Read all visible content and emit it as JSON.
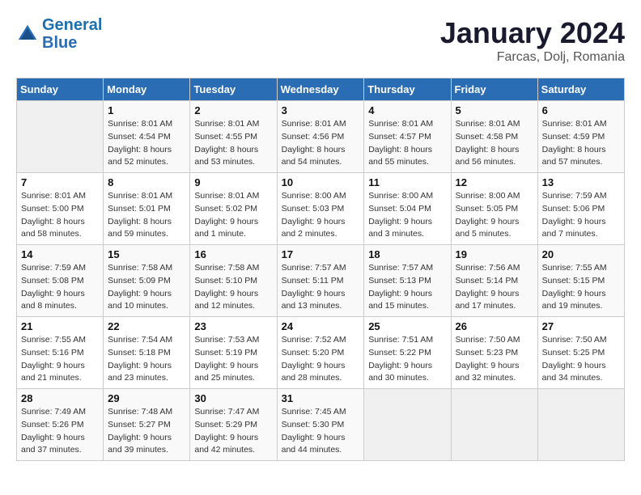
{
  "header": {
    "logo_line1": "General",
    "logo_line2": "Blue",
    "title": "January 2024",
    "subtitle": "Farcas, Dolj, Romania"
  },
  "weekdays": [
    "Sunday",
    "Monday",
    "Tuesday",
    "Wednesday",
    "Thursday",
    "Friday",
    "Saturday"
  ],
  "weeks": [
    [
      {
        "day": "",
        "sunrise": "",
        "sunset": "",
        "daylight": ""
      },
      {
        "day": "1",
        "sunrise": "Sunrise: 8:01 AM",
        "sunset": "Sunset: 4:54 PM",
        "daylight": "Daylight: 8 hours and 52 minutes."
      },
      {
        "day": "2",
        "sunrise": "Sunrise: 8:01 AM",
        "sunset": "Sunset: 4:55 PM",
        "daylight": "Daylight: 8 hours and 53 minutes."
      },
      {
        "day": "3",
        "sunrise": "Sunrise: 8:01 AM",
        "sunset": "Sunset: 4:56 PM",
        "daylight": "Daylight: 8 hours and 54 minutes."
      },
      {
        "day": "4",
        "sunrise": "Sunrise: 8:01 AM",
        "sunset": "Sunset: 4:57 PM",
        "daylight": "Daylight: 8 hours and 55 minutes."
      },
      {
        "day": "5",
        "sunrise": "Sunrise: 8:01 AM",
        "sunset": "Sunset: 4:58 PM",
        "daylight": "Daylight: 8 hours and 56 minutes."
      },
      {
        "day": "6",
        "sunrise": "Sunrise: 8:01 AM",
        "sunset": "Sunset: 4:59 PM",
        "daylight": "Daylight: 8 hours and 57 minutes."
      }
    ],
    [
      {
        "day": "7",
        "sunrise": "Sunrise: 8:01 AM",
        "sunset": "Sunset: 5:00 PM",
        "daylight": "Daylight: 8 hours and 58 minutes."
      },
      {
        "day": "8",
        "sunrise": "Sunrise: 8:01 AM",
        "sunset": "Sunset: 5:01 PM",
        "daylight": "Daylight: 8 hours and 59 minutes."
      },
      {
        "day": "9",
        "sunrise": "Sunrise: 8:01 AM",
        "sunset": "Sunset: 5:02 PM",
        "daylight": "Daylight: 9 hours and 1 minute."
      },
      {
        "day": "10",
        "sunrise": "Sunrise: 8:00 AM",
        "sunset": "Sunset: 5:03 PM",
        "daylight": "Daylight: 9 hours and 2 minutes."
      },
      {
        "day": "11",
        "sunrise": "Sunrise: 8:00 AM",
        "sunset": "Sunset: 5:04 PM",
        "daylight": "Daylight: 9 hours and 3 minutes."
      },
      {
        "day": "12",
        "sunrise": "Sunrise: 8:00 AM",
        "sunset": "Sunset: 5:05 PM",
        "daylight": "Daylight: 9 hours and 5 minutes."
      },
      {
        "day": "13",
        "sunrise": "Sunrise: 7:59 AM",
        "sunset": "Sunset: 5:06 PM",
        "daylight": "Daylight: 9 hours and 7 minutes."
      }
    ],
    [
      {
        "day": "14",
        "sunrise": "Sunrise: 7:59 AM",
        "sunset": "Sunset: 5:08 PM",
        "daylight": "Daylight: 9 hours and 8 minutes."
      },
      {
        "day": "15",
        "sunrise": "Sunrise: 7:58 AM",
        "sunset": "Sunset: 5:09 PM",
        "daylight": "Daylight: 9 hours and 10 minutes."
      },
      {
        "day": "16",
        "sunrise": "Sunrise: 7:58 AM",
        "sunset": "Sunset: 5:10 PM",
        "daylight": "Daylight: 9 hours and 12 minutes."
      },
      {
        "day": "17",
        "sunrise": "Sunrise: 7:57 AM",
        "sunset": "Sunset: 5:11 PM",
        "daylight": "Daylight: 9 hours and 13 minutes."
      },
      {
        "day": "18",
        "sunrise": "Sunrise: 7:57 AM",
        "sunset": "Sunset: 5:13 PM",
        "daylight": "Daylight: 9 hours and 15 minutes."
      },
      {
        "day": "19",
        "sunrise": "Sunrise: 7:56 AM",
        "sunset": "Sunset: 5:14 PM",
        "daylight": "Daylight: 9 hours and 17 minutes."
      },
      {
        "day": "20",
        "sunrise": "Sunrise: 7:55 AM",
        "sunset": "Sunset: 5:15 PM",
        "daylight": "Daylight: 9 hours and 19 minutes."
      }
    ],
    [
      {
        "day": "21",
        "sunrise": "Sunrise: 7:55 AM",
        "sunset": "Sunset: 5:16 PM",
        "daylight": "Daylight: 9 hours and 21 minutes."
      },
      {
        "day": "22",
        "sunrise": "Sunrise: 7:54 AM",
        "sunset": "Sunset: 5:18 PM",
        "daylight": "Daylight: 9 hours and 23 minutes."
      },
      {
        "day": "23",
        "sunrise": "Sunrise: 7:53 AM",
        "sunset": "Sunset: 5:19 PM",
        "daylight": "Daylight: 9 hours and 25 minutes."
      },
      {
        "day": "24",
        "sunrise": "Sunrise: 7:52 AM",
        "sunset": "Sunset: 5:20 PM",
        "daylight": "Daylight: 9 hours and 28 minutes."
      },
      {
        "day": "25",
        "sunrise": "Sunrise: 7:51 AM",
        "sunset": "Sunset: 5:22 PM",
        "daylight": "Daylight: 9 hours and 30 minutes."
      },
      {
        "day": "26",
        "sunrise": "Sunrise: 7:50 AM",
        "sunset": "Sunset: 5:23 PM",
        "daylight": "Daylight: 9 hours and 32 minutes."
      },
      {
        "day": "27",
        "sunrise": "Sunrise: 7:50 AM",
        "sunset": "Sunset: 5:25 PM",
        "daylight": "Daylight: 9 hours and 34 minutes."
      }
    ],
    [
      {
        "day": "28",
        "sunrise": "Sunrise: 7:49 AM",
        "sunset": "Sunset: 5:26 PM",
        "daylight": "Daylight: 9 hours and 37 minutes."
      },
      {
        "day": "29",
        "sunrise": "Sunrise: 7:48 AM",
        "sunset": "Sunset: 5:27 PM",
        "daylight": "Daylight: 9 hours and 39 minutes."
      },
      {
        "day": "30",
        "sunrise": "Sunrise: 7:47 AM",
        "sunset": "Sunset: 5:29 PM",
        "daylight": "Daylight: 9 hours and 42 minutes."
      },
      {
        "day": "31",
        "sunrise": "Sunrise: 7:45 AM",
        "sunset": "Sunset: 5:30 PM",
        "daylight": "Daylight: 9 hours and 44 minutes."
      },
      {
        "day": "",
        "sunrise": "",
        "sunset": "",
        "daylight": ""
      },
      {
        "day": "",
        "sunrise": "",
        "sunset": "",
        "daylight": ""
      },
      {
        "day": "",
        "sunrise": "",
        "sunset": "",
        "daylight": ""
      }
    ]
  ]
}
